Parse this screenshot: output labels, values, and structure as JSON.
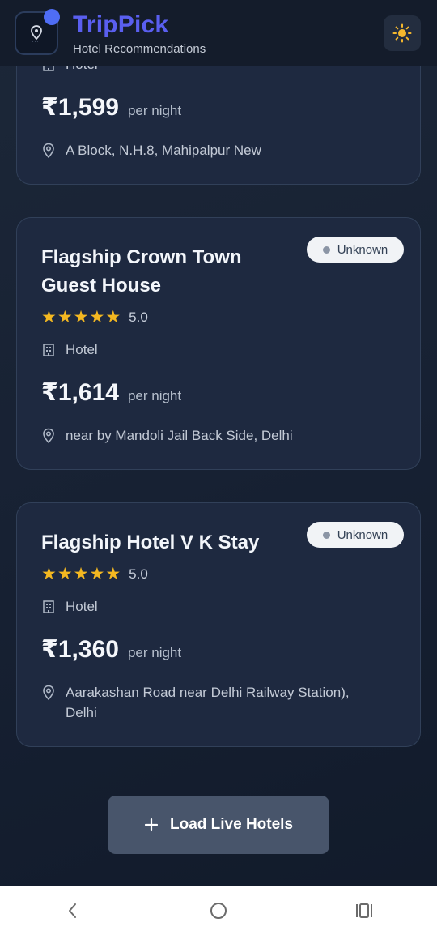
{
  "header": {
    "title": "TripPick",
    "subtitle": "Hotel Recommendations",
    "logo_icon": "location-pin-logo-icon",
    "theme_icon": "sun-icon",
    "accent_color": "#5a5ff0"
  },
  "cards": [
    {
      "type_label": "Hotel",
      "price": "₹1,599",
      "per_night": "per night",
      "address": "A Block, N.H.8, Mahipalpur New"
    },
    {
      "name": "Flagship Crown Town Guest House",
      "badge": "Unknown",
      "stars": 5,
      "rating": "5.0",
      "type_label": "Hotel",
      "price": "₹1,614",
      "per_night": "per night",
      "address": "near by Mandoli Jail Back Side, Delhi"
    },
    {
      "name": "Flagship Hotel V K Stay",
      "badge": "Unknown",
      "stars": 5,
      "rating": "5.0",
      "type_label": "Hotel",
      "price": "₹1,360",
      "per_night": "per night",
      "address": "Aarakashan Road near Delhi Railway Station), Delhi"
    }
  ],
  "load_button": {
    "label": "Load Live Hotels",
    "icon": "plus-icon"
  },
  "navbar": {
    "back_icon": "back-chevron-icon",
    "home_icon": "home-circle-icon",
    "recents_icon": "recent-apps-icon"
  }
}
